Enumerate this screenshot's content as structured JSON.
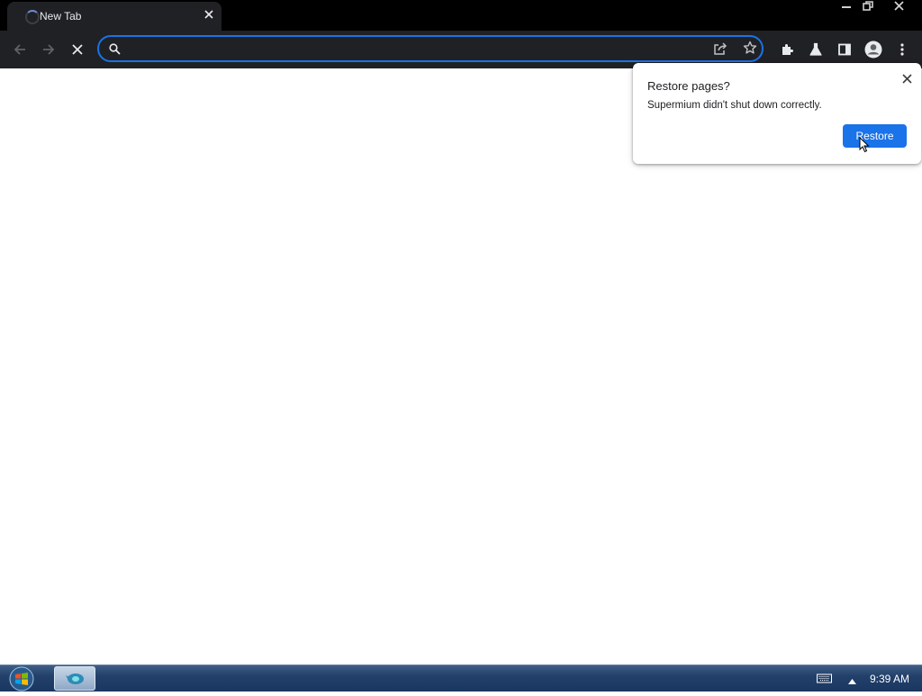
{
  "browser": {
    "tab": {
      "title": "New Tab"
    },
    "omnibox": {
      "value": "",
      "placeholder": ""
    }
  },
  "restore_bubble": {
    "title": "Restore pages?",
    "message": "Supermium didn't shut down correctly.",
    "button_label": "Restore"
  },
  "taskbar": {
    "clock": "9:39 AM"
  },
  "colors": {
    "accent": "#1a73e8",
    "toolbar_bg": "#202124",
    "titlebar_bg": "#000000"
  },
  "icons": [
    "back-arrow-icon",
    "forward-arrow-icon",
    "stop-loading-icon",
    "search-icon",
    "share-icon",
    "bookmark-star-icon",
    "extensions-icon",
    "labs-flask-icon",
    "side-panel-icon",
    "profile-icon",
    "menu-icon",
    "close-icon",
    "windows-start-icon",
    "keyboard-icon",
    "tray-arrow-icon"
  ]
}
